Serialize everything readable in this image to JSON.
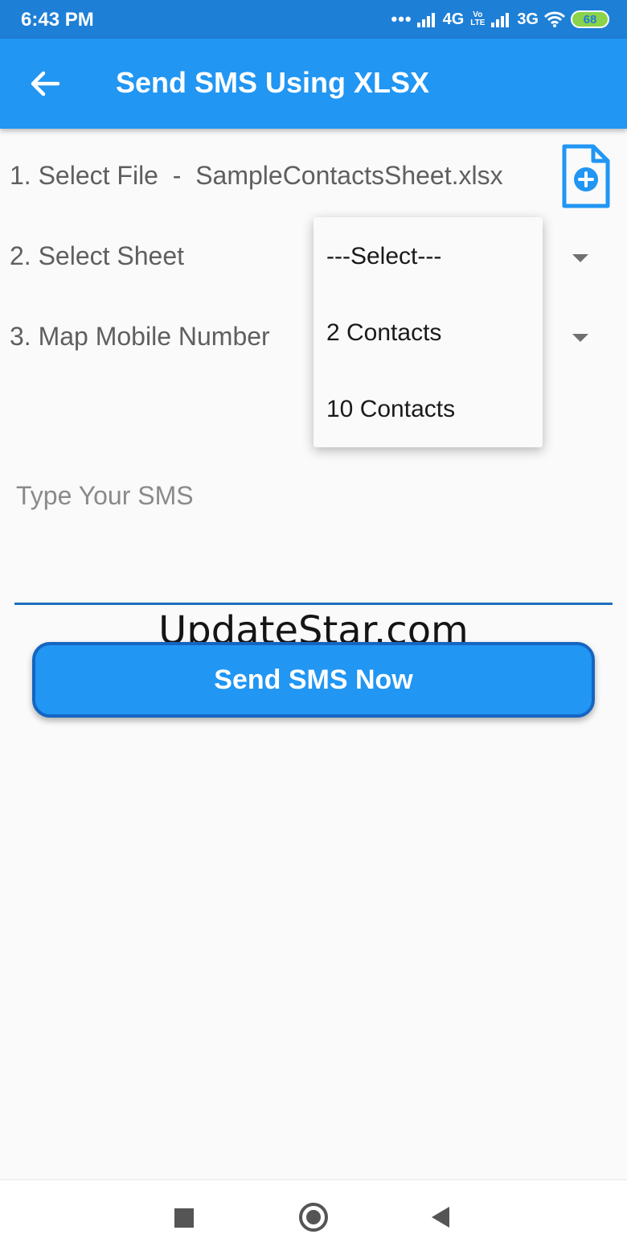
{
  "status_bar": {
    "time": "6:43 PM",
    "network_1": "4G",
    "volte": "Vo LTE",
    "network_2": "3G",
    "battery": "68"
  },
  "app_bar": {
    "title": "Send SMS Using XLSX",
    "back_icon": "arrow-back-icon"
  },
  "form": {
    "select_file_label": "1. Select File  -  SampleContactsSheet.xlsx",
    "file_add_icon": "file-add-icon",
    "select_sheet_label": "2. Select Sheet",
    "map_mobile_label": "3. Map Mobile Number",
    "sheet_dropdown": {
      "options": [
        "---Select---",
        "2 Contacts",
        "10 Contacts"
      ]
    },
    "sms_placeholder": "Type Your SMS",
    "send_button_label": "Send SMS Now"
  },
  "watermark": "UpdateStar.com",
  "colors": {
    "primary": "#2196f3",
    "primary_dark": "#1e7fd6",
    "button_border": "#1565c0"
  },
  "nav_bar": {
    "recents_icon": "square-icon",
    "home_icon": "circle-icon",
    "back_icon": "triangle-back-icon"
  }
}
